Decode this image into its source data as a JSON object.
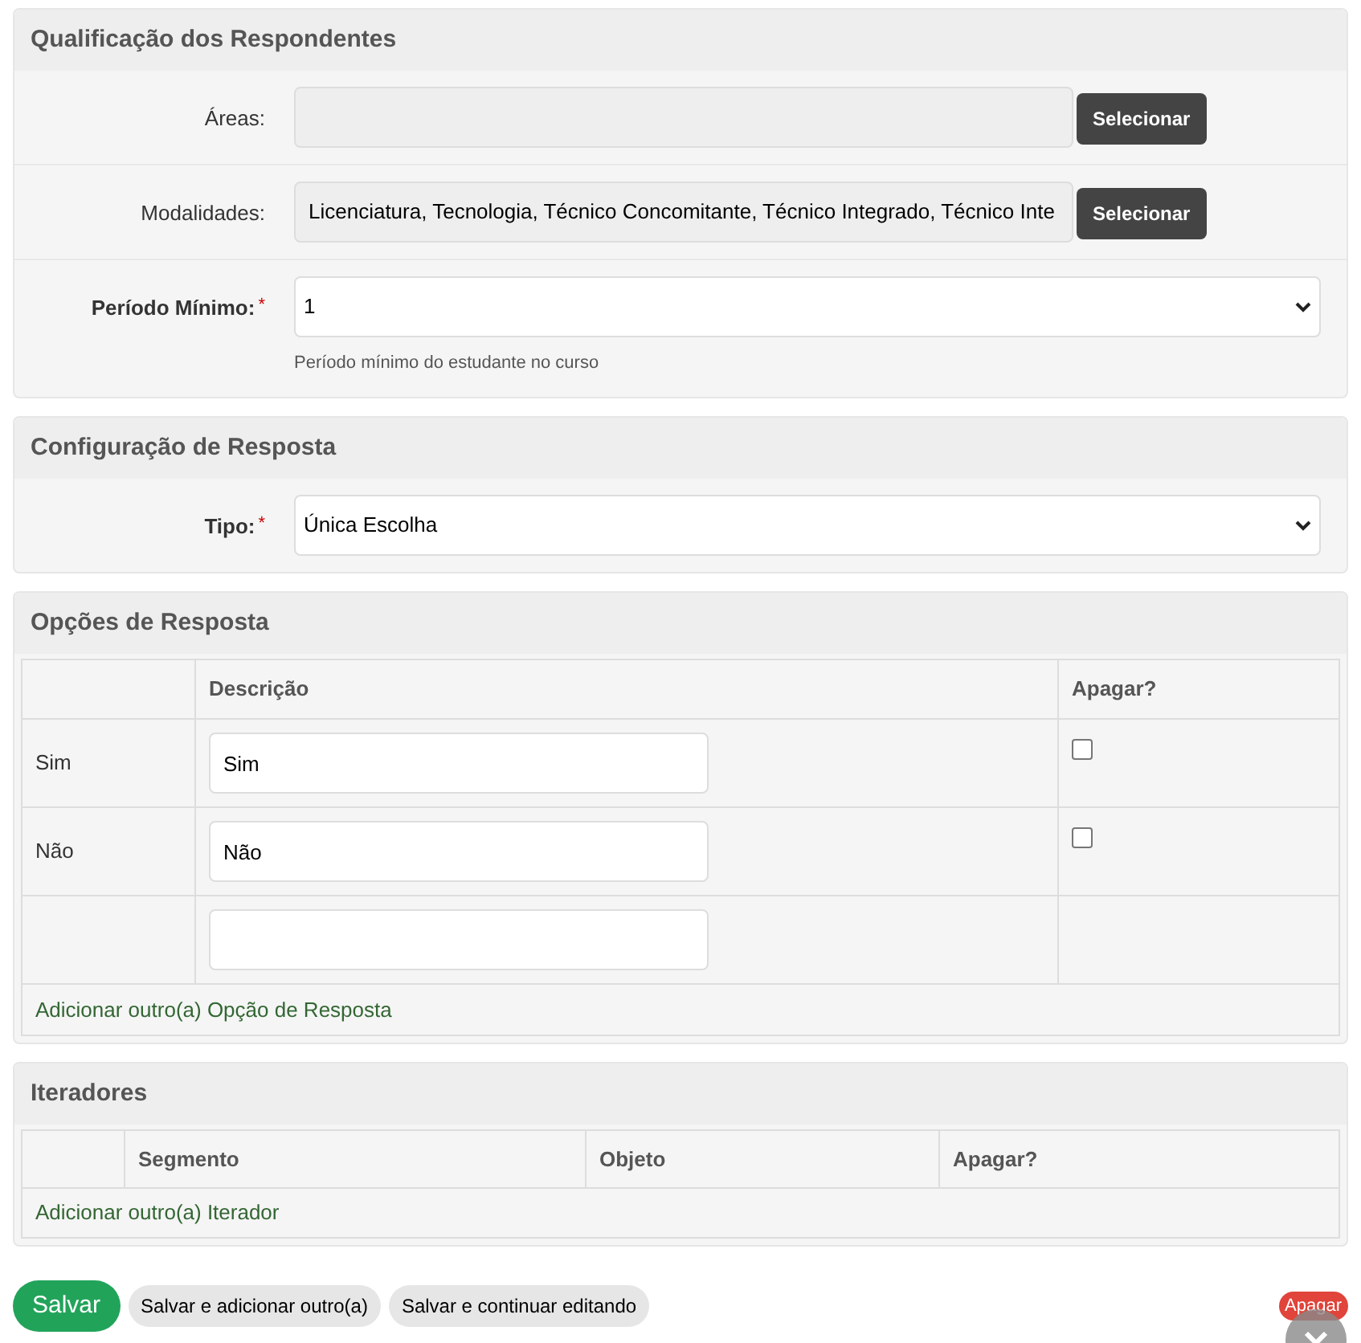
{
  "qualificacao": {
    "title": "Qualificação dos Respondentes",
    "fields": [
      {
        "kind": "picker",
        "label": "Áreas:",
        "button": "Selecionar"
      },
      {
        "kind": "picker",
        "label": "Modalidades:",
        "value": "Licenciatura, Tecnologia, Técnico Concomitante, Técnico Integrado, Técnico Inte",
        "button": "Selecionar"
      },
      {
        "kind": "select",
        "label": "Período Mínimo:",
        "required_mark": "*",
        "value": "1",
        "help": "Período mínimo do estudante no curso"
      }
    ]
  },
  "configuracao": {
    "title": "Configuração de Resposta",
    "fields": [
      {
        "kind": "select",
        "label": "Tipo:",
        "required_mark": "*",
        "value": "Única Escolha"
      }
    ]
  },
  "opcoes": {
    "title": "Opções de Resposta",
    "columns": [
      "Descrição",
      "Apagar?"
    ],
    "rows": [
      {
        "kind": "option",
        "label": "Sim",
        "value": "Sim",
        "checked": false
      },
      {
        "kind": "option",
        "label": "Não",
        "value": "Não",
        "checked": false
      },
      {
        "kind": "empty"
      }
    ],
    "add_link": "Adicionar outro(a) Opção de Resposta"
  },
  "iteradores": {
    "title": "Iteradores",
    "columns": [
      "Segmento",
      "Objeto",
      "Apagar?"
    ],
    "add_link": "Adicionar outro(a) Iterador"
  },
  "actions": {
    "save": "Salvar",
    "save_add": "Salvar e adicionar outro(a)",
    "save_continue": "Salvar e continuar editando",
    "delete": "Apagar"
  }
}
